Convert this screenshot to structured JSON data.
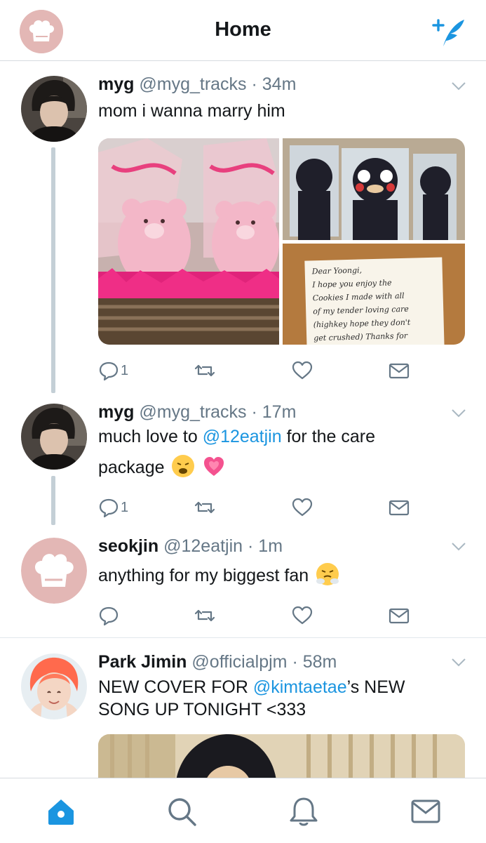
{
  "header": {
    "title": "Home",
    "account_avatar_icon": "chef-hat-icon",
    "compose_icon": "compose-tweet-icon",
    "accent_color": "#1b95e0"
  },
  "tweets": [
    {
      "name": "myg",
      "handle": "@myg_tracks",
      "dot": "·",
      "time": "34m",
      "text": "mom i wanna marry him",
      "media": {
        "note_lines": [
          "Dear Yoongi,",
          "I hope you enjoy the",
          "Cookies I made with all",
          "of my tender loving care",
          "(highkey hope they don't",
          "get crushed) Thanks for"
        ]
      },
      "reply_count": "1"
    },
    {
      "name": "myg",
      "handle": "@myg_tracks",
      "dot": "·",
      "time": "17m",
      "text_before": "much love to ",
      "mention": "@12eatjin",
      "text_after": " for the care",
      "text_line2": "package",
      "reply_count": "1"
    },
    {
      "name": "seokjin",
      "handle": "@12eatjin",
      "dot": "·",
      "time": "1m",
      "text": "anything for my biggest fan"
    },
    {
      "name": "Park Jimin",
      "handle": "@officialpjm",
      "dot": "·",
      "time": "58m",
      "text_line1_before": "NEW COVER FOR ",
      "mention": "@kimtaetae",
      "text_line1_after": "’s NEW",
      "text_line2": "SONG UP TONIGHT <333"
    }
  ],
  "tabbar": {
    "items": [
      "home-icon",
      "search-icon",
      "notifications-icon",
      "messages-icon"
    ],
    "active": "home-icon"
  }
}
